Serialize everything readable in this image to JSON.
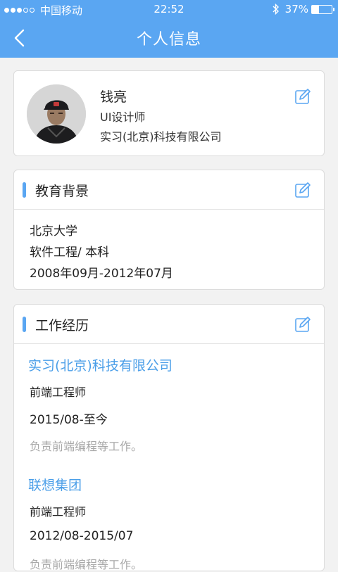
{
  "status_bar": {
    "carrier": "中国移动",
    "time": "22:52",
    "battery_percent": "37%",
    "battery_level": 0.37
  },
  "navbar": {
    "title": "个人信息",
    "back_icon": "chevron-left-icon",
    "color": "#5aa6f2"
  },
  "profile": {
    "name": "钱亮",
    "job_title": "UI设计师",
    "company": "实习(北京)科技有限公司",
    "edit_icon": "edit-icon"
  },
  "education": {
    "section_title": "教育背景",
    "school": "北京大学",
    "major_degree": "软件工程/ 本科",
    "period": "2008年09月-2012年07月"
  },
  "work": {
    "section_title": "工作经历",
    "entries": [
      {
        "company": "实习(北京)科技有限公司",
        "role": "前端工程师",
        "period": "2015/08-至今",
        "description": "负责前端编程等工作。"
      },
      {
        "company": "联想集团",
        "role": "前端工程师",
        "period": "2012/08-2015/07",
        "description": "负责前端编程等工作。"
      }
    ]
  }
}
